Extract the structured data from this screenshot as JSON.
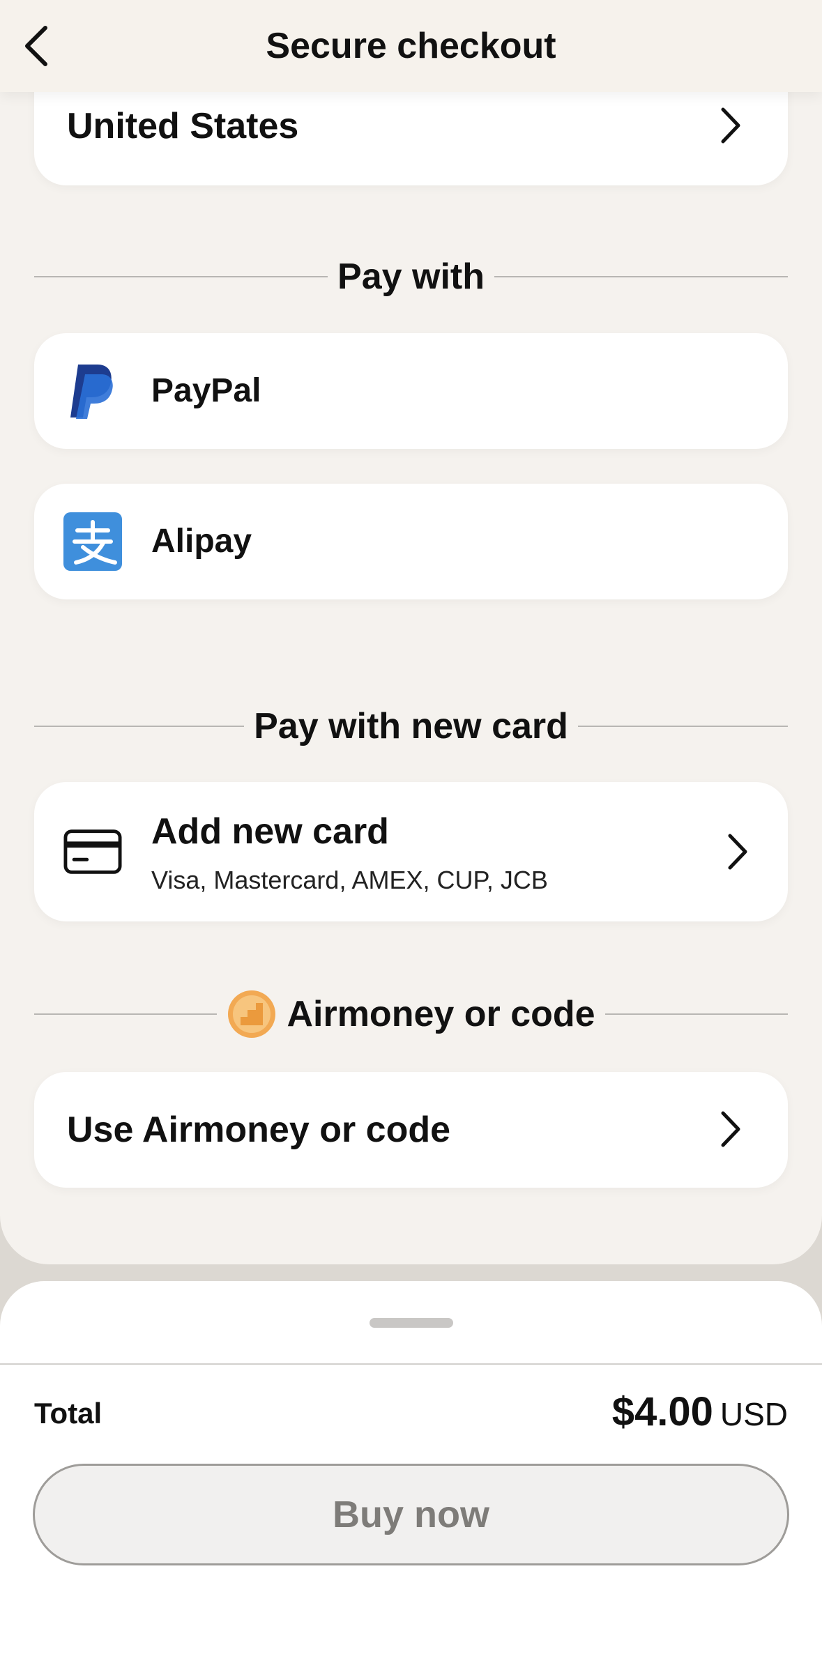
{
  "header": {
    "title": "Secure checkout"
  },
  "country": {
    "value": "United States"
  },
  "sections": {
    "pay_with": "Pay with",
    "pay_with_new_card": "Pay with new card",
    "airmoney": "Airmoney or code"
  },
  "payment_methods": [
    {
      "label": "PayPal",
      "icon": "paypal-icon"
    },
    {
      "label": "Alipay",
      "icon": "alipay-icon"
    }
  ],
  "new_card": {
    "title": "Add new card",
    "subtitle": "Visa, Mastercard, AMEX, CUP, JCB",
    "icon": "credit-card-icon"
  },
  "airmoney_row": {
    "label": "Use Airmoney or code"
  },
  "summary": {
    "total_label": "Total",
    "amount": "$4.00",
    "currency": "USD",
    "buy_label": "Buy now"
  },
  "colors": {
    "paypal_dark": "#1d3c8f",
    "paypal_light": "#2a6fd6",
    "alipay_blue": "#3f8fdc",
    "coin_orange": "#f2a953",
    "background": "#f5f2ee"
  }
}
